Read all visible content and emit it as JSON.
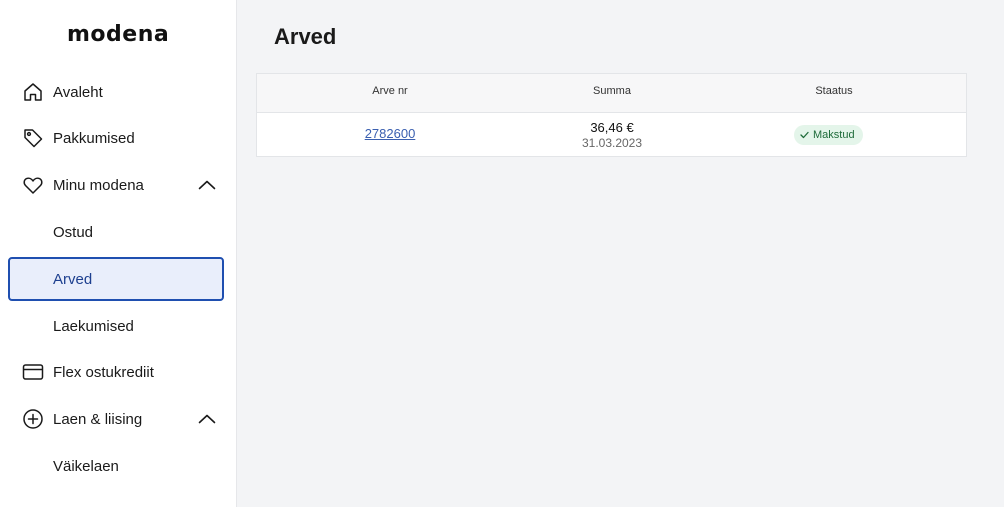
{
  "brand": {
    "logo_text": "modena"
  },
  "sidebar": {
    "items": [
      {
        "label": "Avaleht",
        "icon": "home-icon"
      },
      {
        "label": "Pakkumised",
        "icon": "tag-icon"
      },
      {
        "label": "Minu modena",
        "icon": "heart-icon",
        "expanded": true
      },
      {
        "label": "Ostud"
      },
      {
        "label": "Arved",
        "active": true
      },
      {
        "label": "Laekumised"
      },
      {
        "label": "Flex ostukrediit",
        "icon": "credit-card-icon"
      },
      {
        "label": "Laen & liising",
        "icon": "plus-circle-icon",
        "expanded": true
      },
      {
        "label": "Väikelaen"
      }
    ]
  },
  "main": {
    "title": "Arved",
    "table": {
      "columns": [
        "Arve nr",
        "Summa",
        "Staatus"
      ],
      "rows": [
        {
          "invoice_no": "2782600",
          "amount": "36,46 €",
          "date": "31.03.2023",
          "status": "Makstud"
        }
      ]
    }
  },
  "colors": {
    "accent": "#1f4fb0",
    "active_bg": "#e9eefb",
    "status_paid_bg": "#e4f5ea",
    "status_paid_text": "#1e6b3a",
    "link": "#3a5fb0"
  }
}
